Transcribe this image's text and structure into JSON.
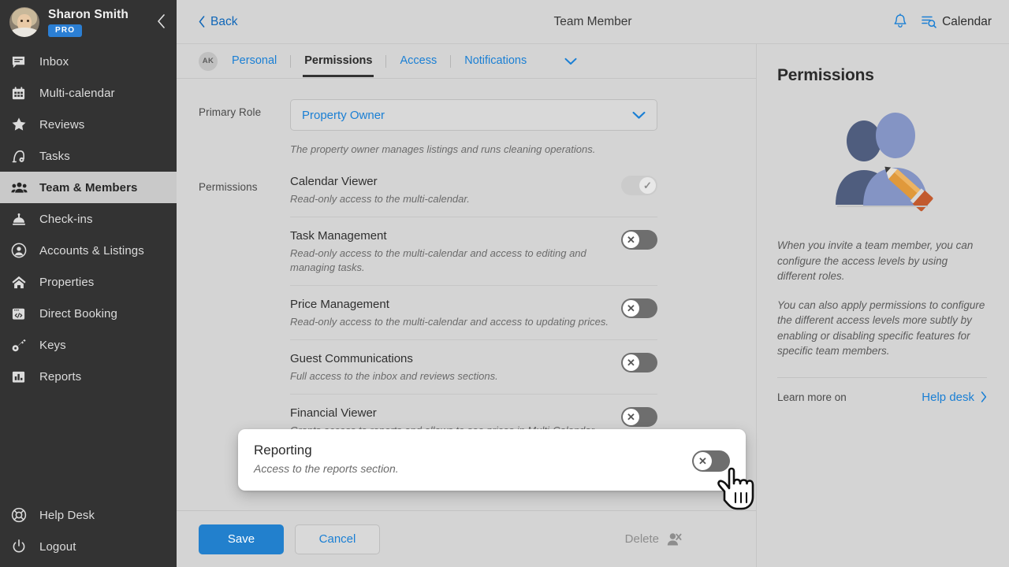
{
  "sidebar": {
    "user": {
      "name": "Sharon Smith",
      "badge": "PRO",
      "avatar_icon": "user-photo-avatar"
    },
    "collapse_icon": "chevron-left-icon",
    "items": [
      {
        "label": "Inbox",
        "icon": "inbox-icon",
        "active": false
      },
      {
        "label": "Multi-calendar",
        "icon": "calendar-icon",
        "active": false
      },
      {
        "label": "Reviews",
        "icon": "star-icon",
        "active": false
      },
      {
        "label": "Tasks",
        "icon": "vacuum-icon",
        "active": false
      },
      {
        "label": "Team & Members",
        "icon": "people-icon",
        "active": true
      },
      {
        "label": "Check-ins",
        "icon": "bell-desk-icon",
        "active": false
      },
      {
        "label": "Accounts & Listings",
        "icon": "account-circle-icon",
        "active": false
      },
      {
        "label": "Properties",
        "icon": "home-icon",
        "active": false
      },
      {
        "label": "Direct Booking",
        "icon": "browser-code-icon",
        "active": false
      },
      {
        "label": "Keys",
        "icon": "key-icon",
        "active": false
      },
      {
        "label": "Reports",
        "icon": "bar-chart-icon",
        "active": false
      }
    ],
    "bottom_items": [
      {
        "label": "Help Desk",
        "icon": "lifebuoy-icon"
      },
      {
        "label": "Logout",
        "icon": "power-icon"
      }
    ]
  },
  "topbar": {
    "back_label": "Back",
    "title": "Team Member",
    "notification_icon": "bell-icon",
    "calendar_label": "Calendar",
    "calendar_icon": "calendar-search-icon"
  },
  "tabs": {
    "avatar_initials": "AK",
    "items": [
      {
        "label": "Personal",
        "active": false
      },
      {
        "label": "Permissions",
        "active": true
      },
      {
        "label": "Access",
        "active": false
      },
      {
        "label": "Notifications",
        "active": false
      }
    ],
    "more_icon": "chevron-down-icon"
  },
  "form": {
    "primary_role_label": "Primary Role",
    "primary_role_value": "Property Owner",
    "primary_role_caret_icon": "chevron-down-icon",
    "primary_role_helper": "The property owner manages listings and runs cleaning operations.",
    "permissions_label": "Permissions",
    "permissions": [
      {
        "title": "Calendar Viewer",
        "desc": "Read-only access to the multi-calendar.",
        "state": "on",
        "glyph": "✓"
      },
      {
        "title": "Task Management",
        "desc": "Read-only access to the multi-calendar and access to editing and managing tasks.",
        "state": "off",
        "glyph": "✕"
      },
      {
        "title": "Price Management",
        "desc": "Read-only access to the multi-calendar and access to updating prices.",
        "state": "off",
        "glyph": "✕"
      },
      {
        "title": "Guest Communications",
        "desc": "Full access to the inbox and reviews sections.",
        "state": "off",
        "glyph": "✕"
      },
      {
        "title": "Financial Viewer",
        "desc": "Grants access to reports and allows to see prices in Multi-Calendar.",
        "state": "off",
        "glyph": "✕"
      }
    ]
  },
  "report_card": {
    "title": "Reporting",
    "desc": "Access to the reports section.",
    "state": "off",
    "glyph": "✕"
  },
  "cursor": {
    "icon": "pointing-hand-cursor"
  },
  "bottom_bar": {
    "save_label": "Save",
    "cancel_label": "Cancel",
    "delete_label": "Delete",
    "delete_icon": "remove-user-icon"
  },
  "right_panel": {
    "title": "Permissions",
    "illustration_icon": "team-permissions-illustration",
    "paragraph1": "When you invite a team member, you can configure the access levels by using different roles.",
    "paragraph2": "You can also apply permissions to configure the different access levels more subtly by enabling or disabling specific features for specific team members.",
    "learn_more_label": "Learn more on",
    "help_desk_label": "Help desk",
    "help_desk_caret_icon": "chevron-right-icon"
  },
  "colors": {
    "accent_blue": "#1a7fd4",
    "save_blue": "#2280cd",
    "sidebar_dark": "#333333",
    "sidebar_active": "#c9c9c9",
    "page_bg": "#d4d4d4",
    "pro_badge": "#2b7fd4",
    "illus_dark": "#4f5d7e",
    "illus_light": "#8494c4",
    "pencil": "#e09a3a"
  }
}
